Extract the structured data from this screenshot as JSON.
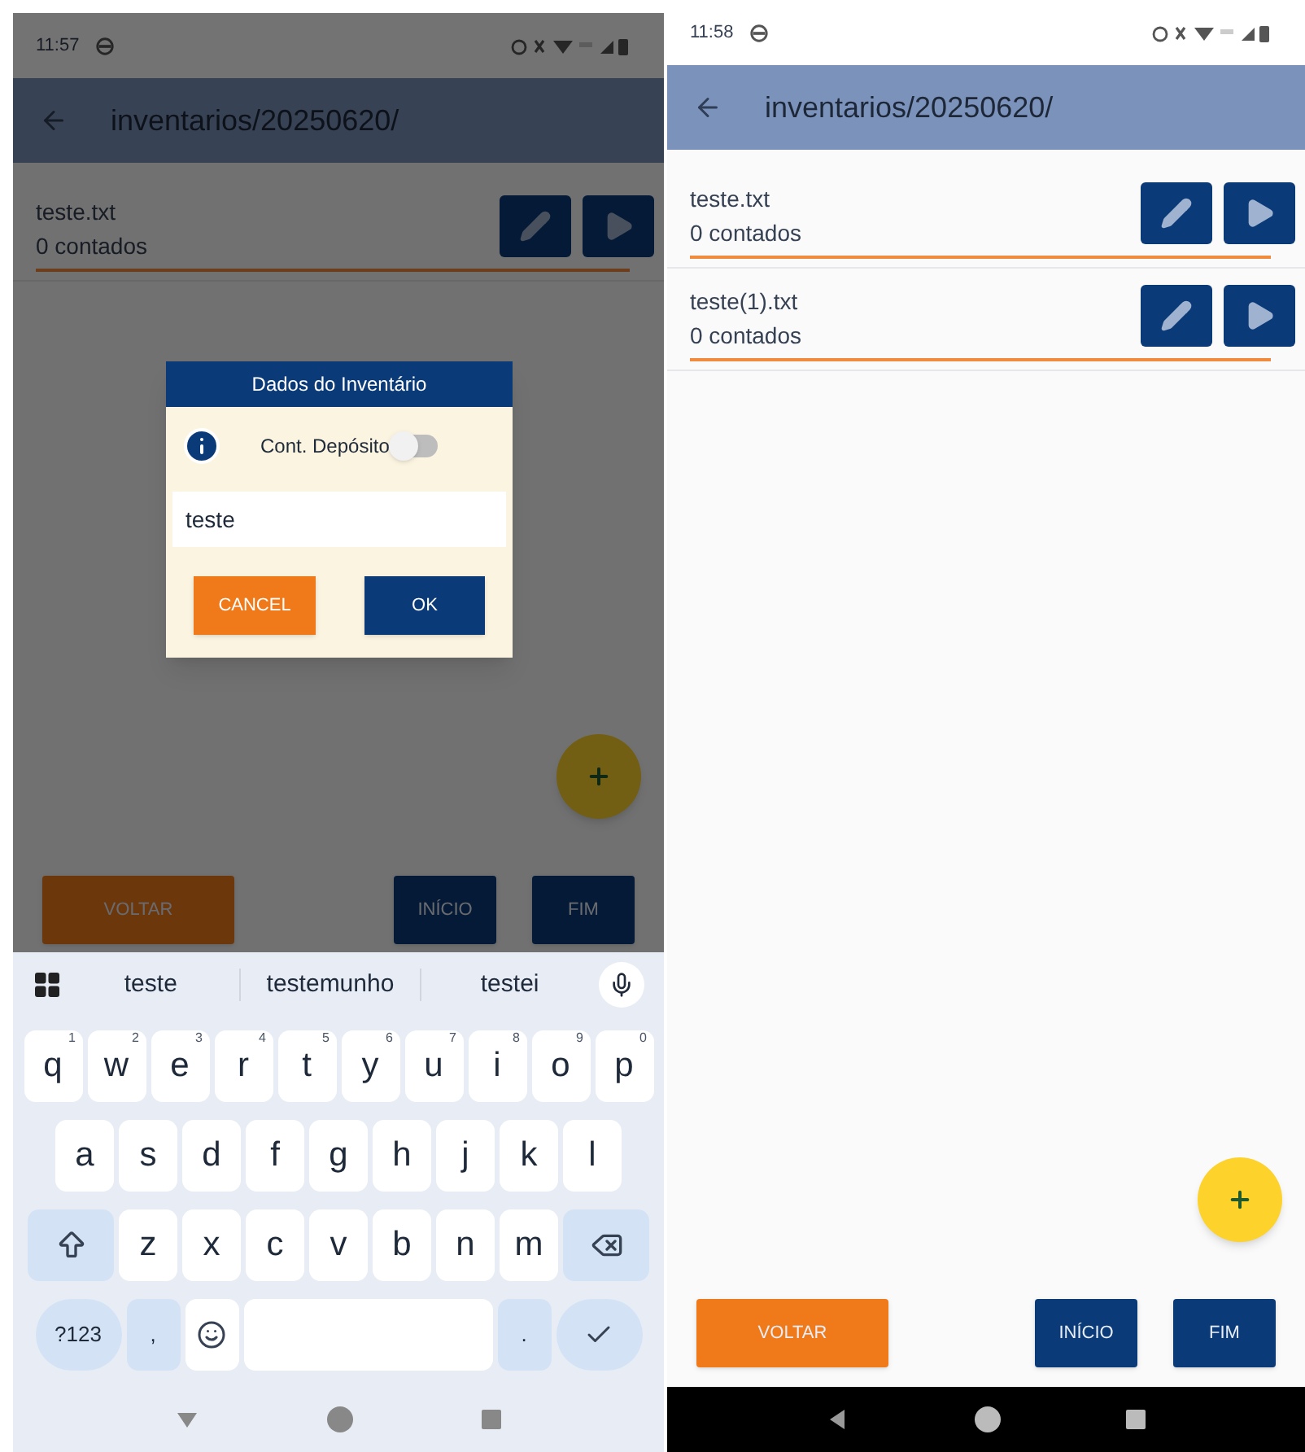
{
  "screens": [
    {
      "status_bar": {
        "time": "11:57"
      },
      "app_bar": {
        "title": "inventarios/20250620/"
      },
      "files": [
        {
          "name": "teste.txt",
          "count": "0 contados"
        }
      ],
      "dialog": {
        "title": "Dados do Inventário",
        "toggle_label": "Cont. Depósito",
        "toggle_on": false,
        "input_value": "teste",
        "buttons": [
          {
            "label": "CANCEL",
            "kind": "cancel"
          },
          {
            "label": "OK",
            "kind": "confirm"
          }
        ]
      },
      "buttons": [
        {
          "label": "VOLTAR",
          "kind": "back"
        },
        {
          "label": "INÍCIO",
          "kind": "nav"
        },
        {
          "label": "FIM",
          "kind": "nav"
        }
      ],
      "keyboard": {
        "suggestions": [
          "teste",
          "testemunho",
          "testei"
        ],
        "rows": [
          {
            "keys": [
              {
                "kind": "letter",
                "label": "q",
                "hint": "1"
              },
              {
                "kind": "letter",
                "label": "w",
                "hint": "2"
              },
              {
                "kind": "letter",
                "label": "e",
                "hint": "3"
              },
              {
                "kind": "letter",
                "label": "r",
                "hint": "4"
              },
              {
                "kind": "letter",
                "label": "t",
                "hint": "5"
              },
              {
                "kind": "letter",
                "label": "y",
                "hint": "6"
              },
              {
                "kind": "letter",
                "label": "u",
                "hint": "7"
              },
              {
                "kind": "letter",
                "label": "i",
                "hint": "8"
              },
              {
                "kind": "letter",
                "label": "o",
                "hint": "9"
              },
              {
                "kind": "letter",
                "label": "p",
                "hint": "0"
              }
            ]
          },
          {
            "keys": [
              {
                "kind": "letter",
                "label": "a"
              },
              {
                "kind": "letter",
                "label": "s"
              },
              {
                "kind": "letter",
                "label": "d"
              },
              {
                "kind": "letter",
                "label": "f"
              },
              {
                "kind": "letter",
                "label": "g"
              },
              {
                "kind": "letter",
                "label": "h"
              },
              {
                "kind": "letter",
                "label": "j"
              },
              {
                "kind": "letter",
                "label": "k"
              },
              {
                "kind": "letter",
                "label": "l"
              }
            ]
          },
          {
            "keys": [
              {
                "kind": "shift"
              },
              {
                "kind": "letter",
                "label": "z"
              },
              {
                "kind": "letter",
                "label": "x"
              },
              {
                "kind": "letter",
                "label": "c"
              },
              {
                "kind": "letter",
                "label": "v"
              },
              {
                "kind": "letter",
                "label": "b"
              },
              {
                "kind": "letter",
                "label": "n"
              },
              {
                "kind": "letter",
                "label": "m"
              },
              {
                "kind": "backspace"
              }
            ]
          },
          {
            "keys": [
              {
                "kind": "symbols",
                "label": "?123"
              },
              {
                "kind": "punctuation",
                "label": ","
              },
              {
                "kind": "emoji"
              },
              {
                "kind": "space"
              },
              {
                "kind": "punctuation",
                "label": "."
              },
              {
                "kind": "enter"
              }
            ]
          }
        ]
      }
    },
    {
      "status_bar": {
        "time": "11:58"
      },
      "app_bar": {
        "title": "inventarios/20250620/"
      },
      "files": [
        {
          "name": "teste.txt",
          "count": "0 contados"
        },
        {
          "name": "teste(1).txt",
          "count": "0 contados"
        }
      ],
      "buttons": [
        {
          "label": "VOLTAR",
          "kind": "back"
        },
        {
          "label": "INÍCIO",
          "kind": "nav"
        },
        {
          "label": "FIM",
          "kind": "nav"
        }
      ]
    }
  ]
}
